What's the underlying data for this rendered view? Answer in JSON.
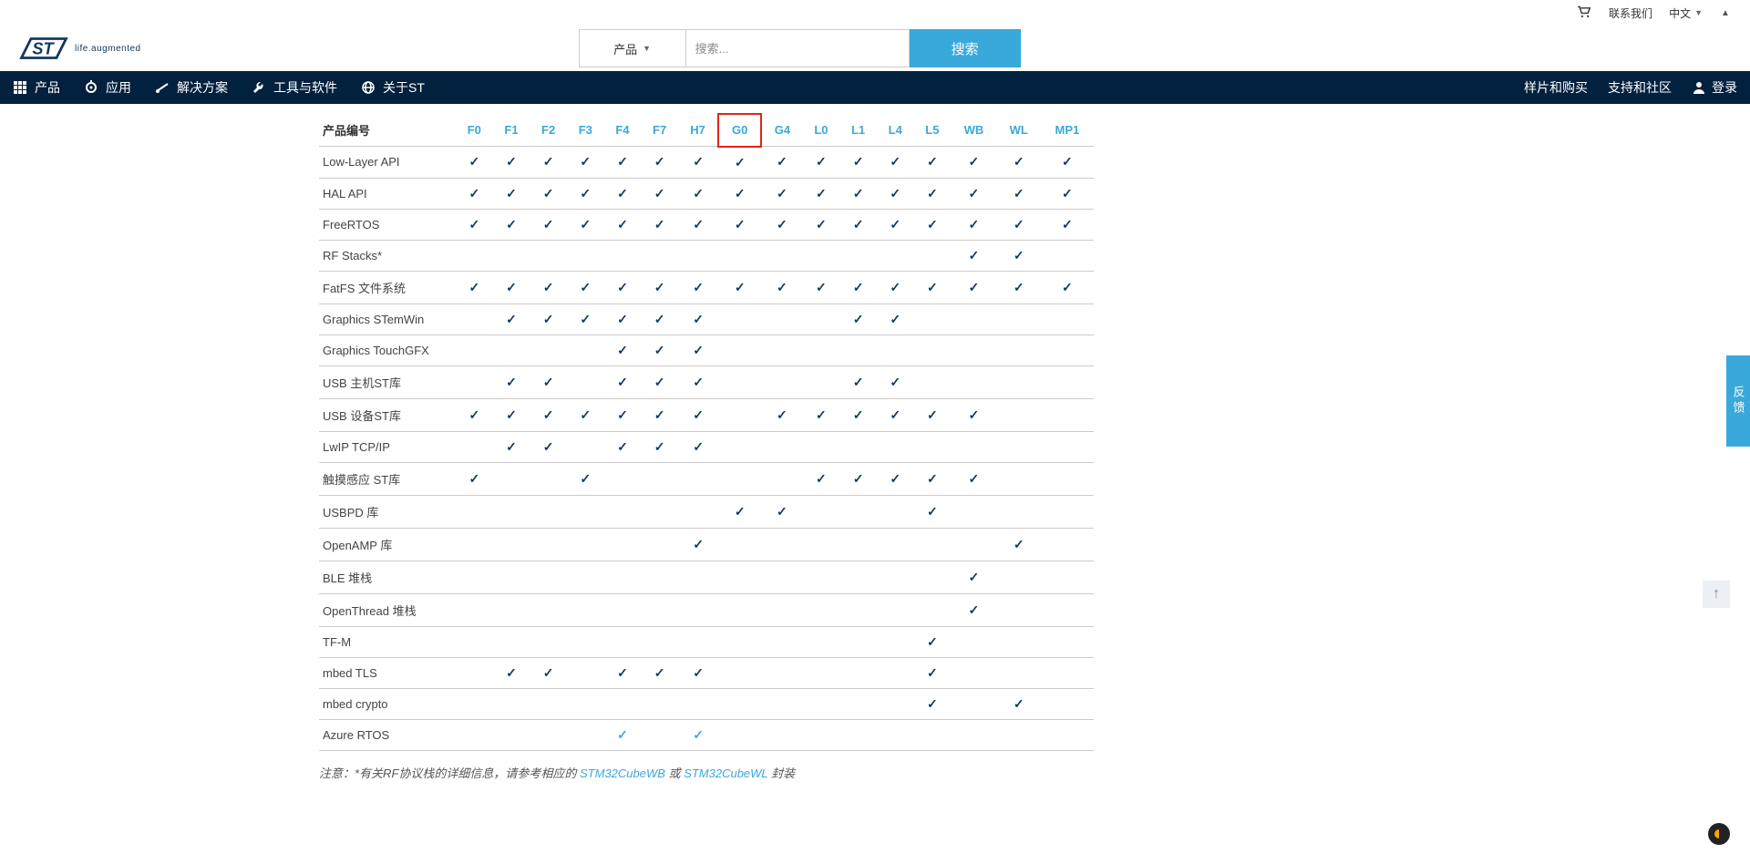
{
  "topbar": {
    "contact": "联系我们",
    "lang": "中文"
  },
  "header": {
    "logo_tag": "life.augmented",
    "product_selector": "产品",
    "search_placeholder": "搜索...",
    "search_button": "搜索"
  },
  "nav": {
    "left": [
      {
        "key": "products",
        "label": "产品"
      },
      {
        "key": "apps",
        "label": "应用"
      },
      {
        "key": "solutions",
        "label": "解决方案"
      },
      {
        "key": "tools",
        "label": "工具与软件"
      },
      {
        "key": "about",
        "label": "关于ST"
      }
    ],
    "right": [
      {
        "key": "samples",
        "label": "样片和购买"
      },
      {
        "key": "support",
        "label": "支持和社区"
      }
    ],
    "login": "登录"
  },
  "table": {
    "row_header": "产品编号",
    "columns": [
      "F0",
      "F1",
      "F2",
      "F3",
      "F4",
      "F7",
      "H7",
      "G0",
      "G4",
      "L0",
      "L1",
      "L4",
      "L5",
      "WB",
      "WL",
      "MP1"
    ],
    "highlight_col": "G0",
    "rows": [
      {
        "label": "Low-Layer API",
        "cells": [
          1,
          1,
          1,
          1,
          1,
          1,
          1,
          1,
          1,
          1,
          1,
          1,
          1,
          1,
          1,
          1
        ]
      },
      {
        "label": "HAL API",
        "cells": [
          1,
          1,
          1,
          1,
          1,
          1,
          1,
          1,
          1,
          1,
          1,
          1,
          1,
          1,
          1,
          1
        ]
      },
      {
        "label": "FreeRTOS",
        "cells": [
          1,
          1,
          1,
          1,
          1,
          1,
          1,
          1,
          1,
          1,
          1,
          1,
          1,
          1,
          1,
          1
        ]
      },
      {
        "label": "RF Stacks*",
        "cells": [
          0,
          0,
          0,
          0,
          0,
          0,
          0,
          0,
          0,
          0,
          0,
          0,
          0,
          1,
          1,
          0
        ]
      },
      {
        "label": "FatFS 文件系统",
        "cells": [
          1,
          1,
          1,
          1,
          1,
          1,
          1,
          1,
          1,
          1,
          1,
          1,
          1,
          1,
          1,
          1
        ]
      },
      {
        "label": "Graphics STemWin",
        "cells": [
          0,
          1,
          1,
          1,
          1,
          1,
          1,
          0,
          0,
          0,
          1,
          1,
          0,
          0,
          0,
          0
        ]
      },
      {
        "label": "Graphics TouchGFX",
        "cells": [
          0,
          0,
          0,
          0,
          1,
          1,
          1,
          0,
          0,
          0,
          0,
          0,
          0,
          0,
          0,
          0
        ]
      },
      {
        "label": "USB 主机ST库",
        "cells": [
          0,
          1,
          1,
          0,
          1,
          1,
          1,
          0,
          0,
          0,
          1,
          1,
          0,
          0,
          0,
          0
        ]
      },
      {
        "label": "USB 设备ST库",
        "cells": [
          1,
          1,
          1,
          1,
          1,
          1,
          1,
          0,
          1,
          1,
          1,
          1,
          1,
          1,
          0,
          0
        ]
      },
      {
        "label": "LwIP TCP/IP",
        "cells": [
          0,
          1,
          1,
          0,
          1,
          1,
          1,
          0,
          0,
          0,
          0,
          0,
          0,
          0,
          0,
          0
        ]
      },
      {
        "label": "触摸感应 ST库",
        "cells": [
          1,
          0,
          0,
          1,
          0,
          0,
          0,
          0,
          0,
          1,
          1,
          1,
          1,
          1,
          0,
          0
        ]
      },
      {
        "label": "USBPD 库",
        "cells": [
          0,
          0,
          0,
          0,
          0,
          0,
          0,
          1,
          1,
          0,
          0,
          0,
          1,
          0,
          0,
          0
        ]
      },
      {
        "label": "OpenAMP 库",
        "cells": [
          0,
          0,
          0,
          0,
          0,
          0,
          1,
          0,
          0,
          0,
          0,
          0,
          0,
          0,
          1,
          0
        ]
      },
      {
        "label": "BLE 堆栈",
        "cells": [
          0,
          0,
          0,
          0,
          0,
          0,
          0,
          0,
          0,
          0,
          0,
          0,
          0,
          1,
          0,
          0
        ]
      },
      {
        "label": "OpenThread 堆栈",
        "cells": [
          0,
          0,
          0,
          0,
          0,
          0,
          0,
          0,
          0,
          0,
          0,
          0,
          0,
          1,
          0,
          0
        ]
      },
      {
        "label": "TF-M",
        "cells": [
          0,
          0,
          0,
          0,
          0,
          0,
          0,
          0,
          0,
          0,
          0,
          0,
          1,
          0,
          0,
          0
        ]
      },
      {
        "label": "mbed TLS",
        "cells": [
          0,
          1,
          1,
          0,
          1,
          1,
          1,
          0,
          0,
          0,
          0,
          0,
          1,
          0,
          0,
          0
        ]
      },
      {
        "label": "mbed crypto",
        "cells": [
          0,
          0,
          0,
          0,
          0,
          0,
          0,
          0,
          0,
          0,
          0,
          0,
          1,
          0,
          1,
          0
        ]
      },
      {
        "label": "Azure RTOS",
        "cells": [
          0,
          0,
          0,
          0,
          2,
          0,
          2,
          0,
          0,
          0,
          0,
          0,
          0,
          0,
          0,
          0
        ]
      }
    ]
  },
  "footnote": {
    "prefix": "注意：*有关RF协议栈的详细信息，请参考相应的 ",
    "link1": "STM32CubeWB",
    "mid": " 或 ",
    "link2": "STM32CubeWL",
    "suffix": " 封装"
  },
  "feedback_tab": "反馈",
  "colors": {
    "accent": "#39a9dc",
    "navy": "#02213f",
    "highlight_border": "#e2231a"
  }
}
